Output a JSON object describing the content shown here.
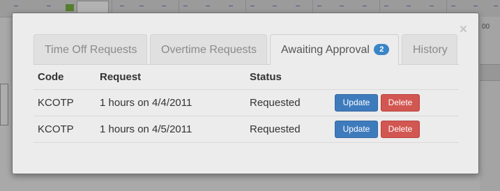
{
  "background": {
    "right_text": "00"
  },
  "dialog": {
    "close_label": "×",
    "tabs": [
      {
        "label": "Time Off Requests",
        "active": false
      },
      {
        "label": "Overtime Requests",
        "active": false
      },
      {
        "label": "Awaiting Approval",
        "active": true,
        "badge": "2"
      },
      {
        "label": "History",
        "active": false
      }
    ],
    "table": {
      "headers": [
        "Code",
        "Request",
        "Status"
      ],
      "rows": [
        {
          "code": "KCOTP",
          "request": "1 hours on 4/4/2011",
          "status": "Requested",
          "update_label": "Update",
          "delete_label": "Delete"
        },
        {
          "code": "KCOTP",
          "request": "1 hours on 4/5/2011",
          "status": "Requested",
          "update_label": "Update",
          "delete_label": "Delete"
        }
      ]
    }
  },
  "colors": {
    "badge": "#3a85c8",
    "update_button": "#3e7bbd",
    "delete_button": "#d25651",
    "overlay": "#8d8d8d"
  }
}
